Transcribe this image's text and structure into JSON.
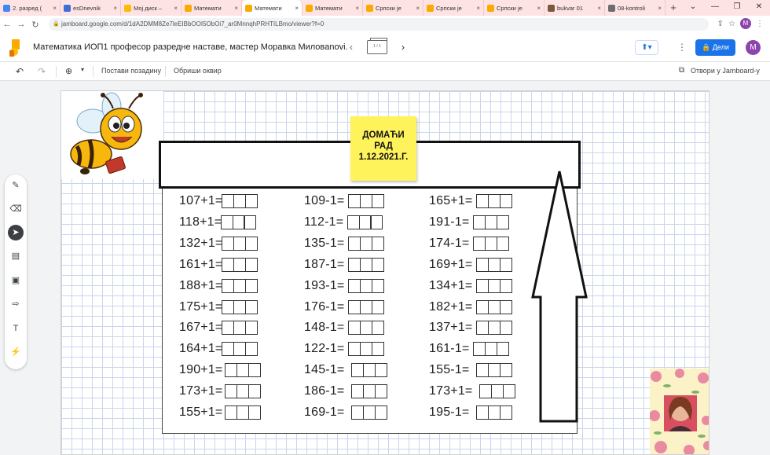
{
  "browser": {
    "tabs": [
      {
        "title": "2. разред (",
        "color": "#4285f4",
        "active": false
      },
      {
        "title": "esDnevnik",
        "color": "#3b6fd6",
        "active": false
      },
      {
        "title": "Мој диск –",
        "color": "#fbbc04",
        "active": false
      },
      {
        "title": "Математи",
        "color": "#f9ab00",
        "active": false
      },
      {
        "title": "Математи",
        "color": "#f9ab00",
        "active": true
      },
      {
        "title": "Математи",
        "color": "#f9ab00",
        "active": false
      },
      {
        "title": "Српски је",
        "color": "#f9ab00",
        "active": false
      },
      {
        "title": "Српски је",
        "color": "#f9ab00",
        "active": false
      },
      {
        "title": "Српски је",
        "color": "#f9ab00",
        "active": false
      },
      {
        "title": "bukvar 01",
        "color": "#7a5a3a",
        "active": false
      },
      {
        "title": "08-kontroli",
        "color": "#6d6d6d",
        "active": false
      }
    ],
    "new_tab": "+",
    "url": "jamboard.google.com/d/1dA2DMM8Ze7leEIBbOOI5ObOi7_ar0MnnqhPRHTILBmo/viewer?f=0",
    "profile_initial": "M"
  },
  "app": {
    "title": "Математика ИОП1 професор разредне наставе, мастер Моравка Миловanovi...",
    "frame_counter": "1 / 1",
    "share_label": "Дели",
    "profile_initial": "M",
    "accent": "#1a73e8"
  },
  "toolbar": {
    "set_background": "Постави позадину",
    "clear_frame": "Обриши оквир",
    "open_in_app": "Отвори у Jamboard-у"
  },
  "side_tools": [
    {
      "icon": "pen-icon",
      "glyph": "✎"
    },
    {
      "icon": "eraser-icon",
      "glyph": "⌫"
    },
    {
      "icon": "select-icon",
      "glyph": "➤"
    },
    {
      "icon": "sticky-note-icon",
      "glyph": "▤"
    },
    {
      "icon": "image-icon",
      "glyph": "▣"
    },
    {
      "icon": "shape-icon",
      "glyph": "⇨"
    },
    {
      "icon": "text-box-icon",
      "glyph": "T"
    },
    {
      "icon": "laser-icon",
      "glyph": "⚡"
    }
  ],
  "sticky_note": {
    "line1": "ДОМАЋИ",
    "line2": "РАД",
    "line3": "1.12.2021.Г.",
    "color": "#fff35c"
  },
  "worksheet": {
    "col1": [
      "107+1=",
      "118+1=",
      "132+1=",
      "161+1=",
      "188+1=",
      "175+1=",
      "167+1=",
      "164+1=",
      "190+1=",
      "173+1=",
      "155+1="
    ],
    "col2": [
      "109-1=",
      "112-1=",
      "135-1=",
      "187-1=",
      "193-1=",
      "176-1=",
      "148-1=",
      "122-1=",
      "145-1=",
      "186-1=",
      "169-1="
    ],
    "col3": [
      "165+1=",
      "191-1=",
      "174-1=",
      "169+1=",
      "134+1=",
      "182+1=",
      "137+1=",
      "161-1=",
      "155-1=",
      "173+1=",
      "195-1="
    ]
  }
}
